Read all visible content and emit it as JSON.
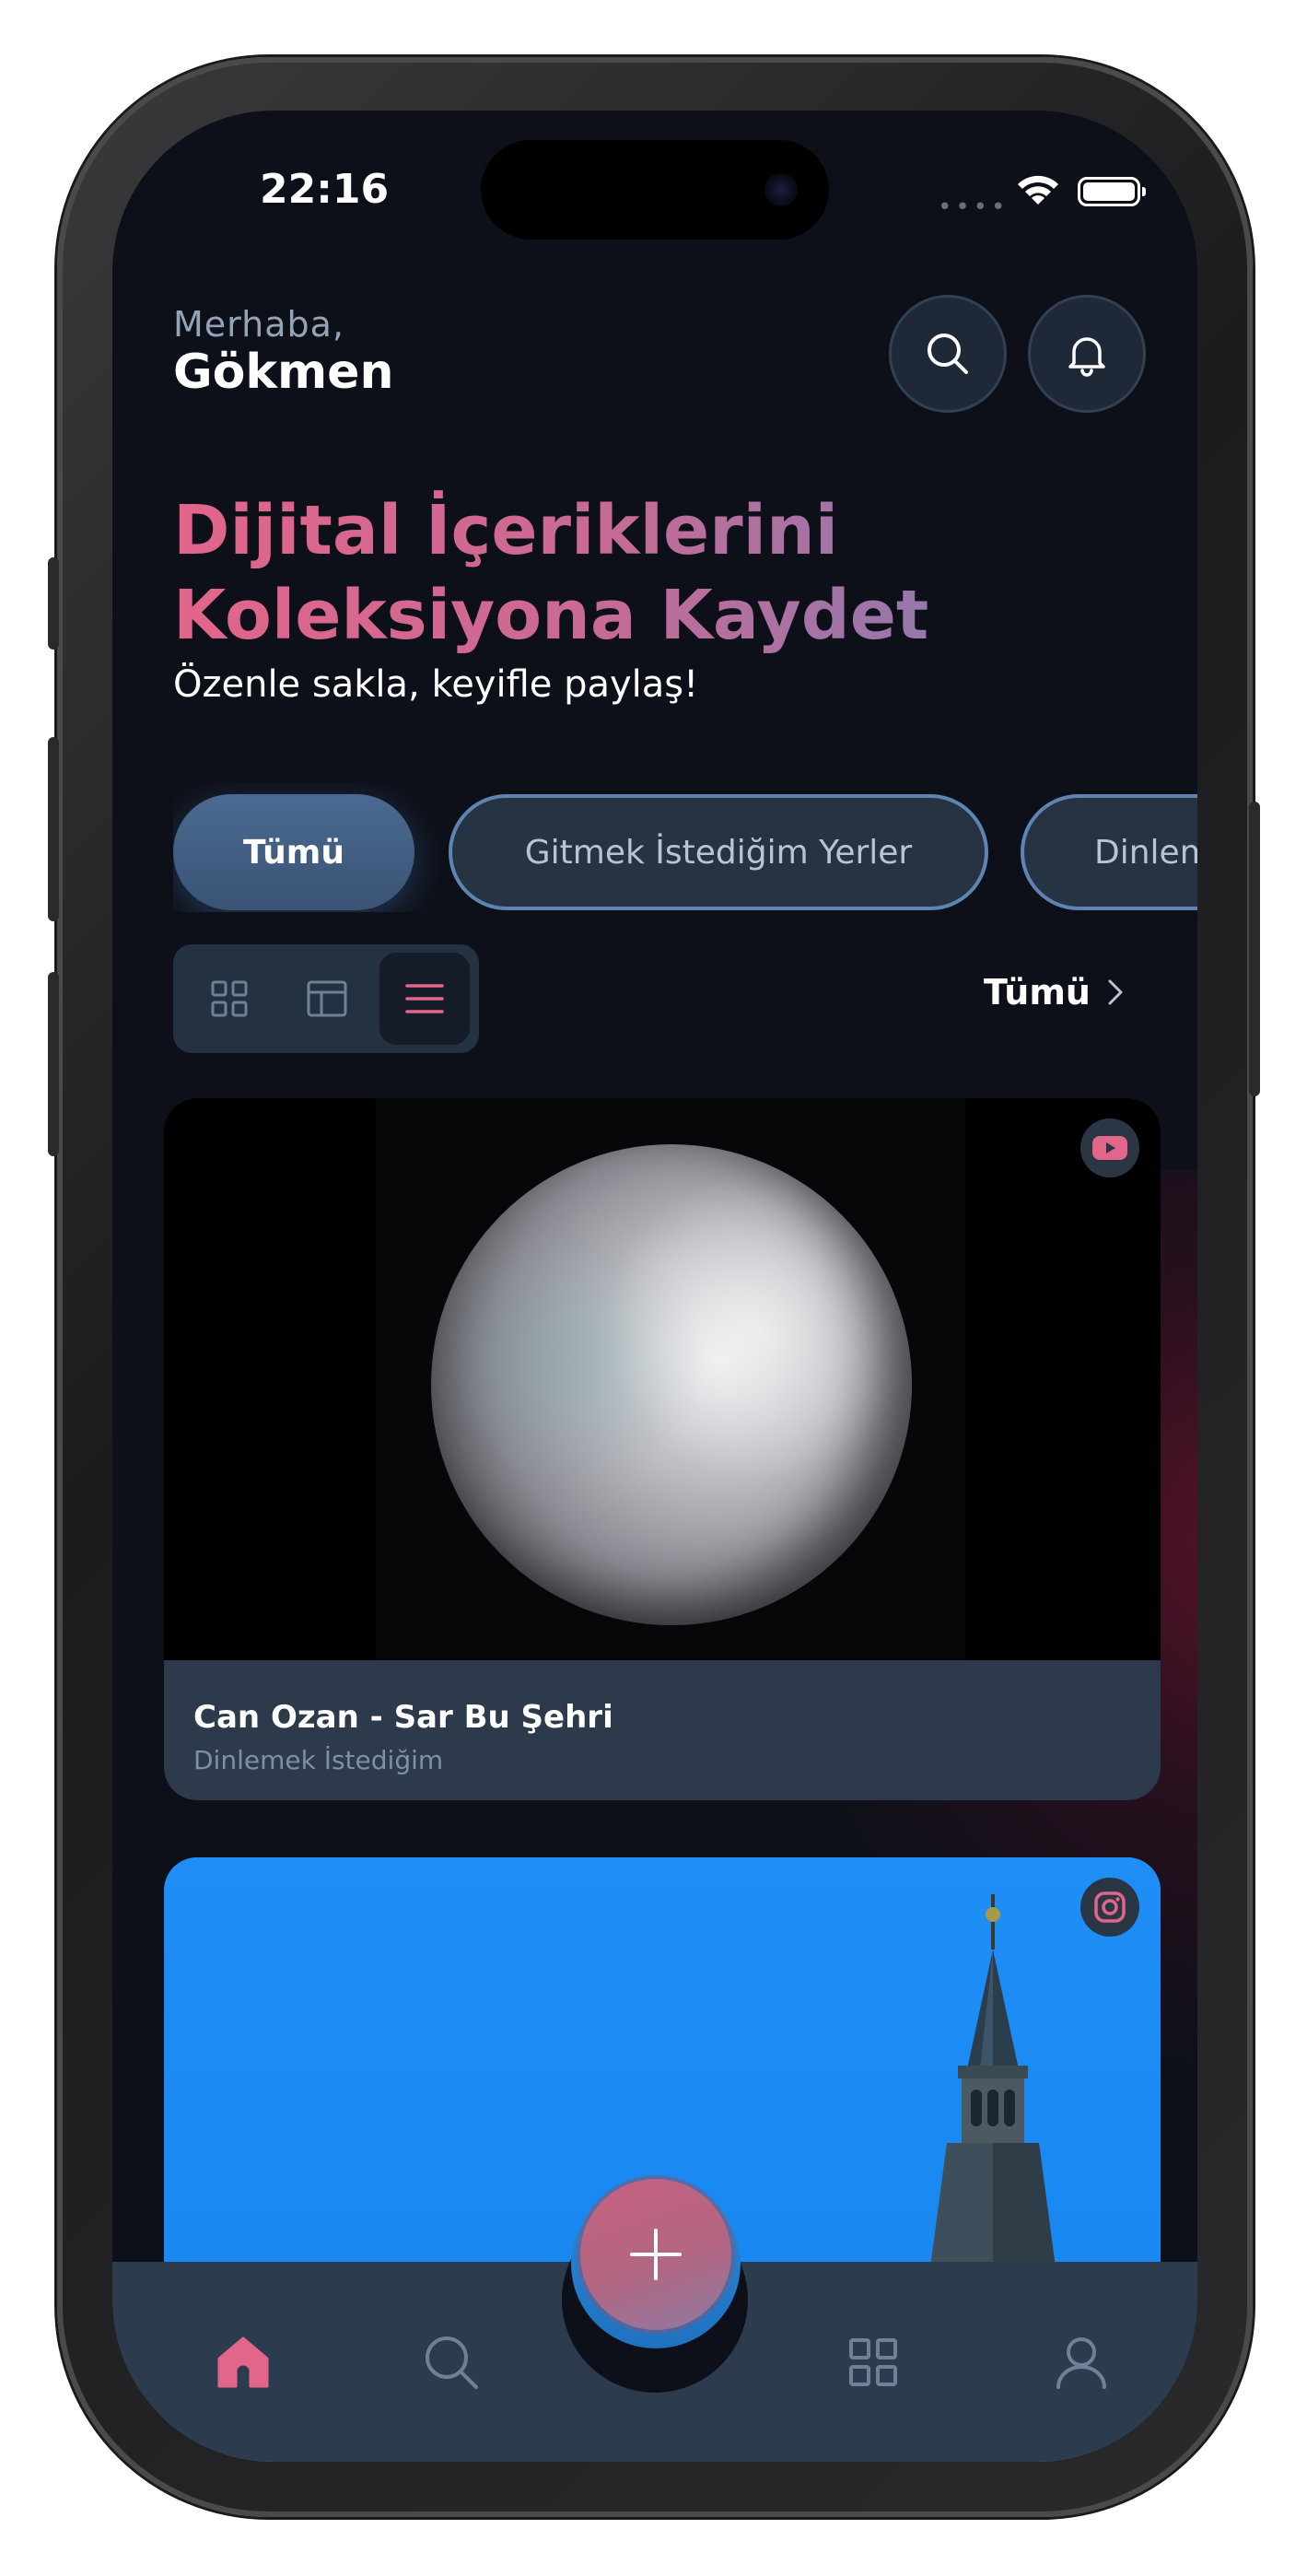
{
  "status_bar": {
    "time": "22:16"
  },
  "header": {
    "greeting": "Merhaba,",
    "user_name": "Gökmen"
  },
  "hero": {
    "title_line1": "Dijital İçeriklerini",
    "title_line2": "Koleksiyona Kaydet",
    "subtitle": "Özenle sakla, keyifle paylaş!"
  },
  "filters": {
    "chips": [
      {
        "label": "Tümü",
        "active": true
      },
      {
        "label": "Gitmek İstediğim Yerler",
        "active": false
      },
      {
        "label": "Dinlemek İstediğim",
        "active": false
      }
    ]
  },
  "toolbar": {
    "view_mode": "list",
    "see_all": "Tümü"
  },
  "cards": [
    {
      "title": "Can Ozan - Sar Bu Şehri",
      "category": "Dinlemek İstediğim",
      "source_icon": "youtube-icon"
    },
    {
      "title": "",
      "category": "",
      "source_icon": "instagram-icon"
    }
  ],
  "tab_bar": {
    "items": [
      "home-icon",
      "search-icon",
      "add-icon",
      "grid-icon",
      "profile-icon"
    ],
    "active": "home-icon"
  },
  "colors": {
    "accent_pink": "#e2658a",
    "accent_blue": "#5e84b2",
    "background": "#0d1018",
    "surface": "#2c3b4d"
  }
}
